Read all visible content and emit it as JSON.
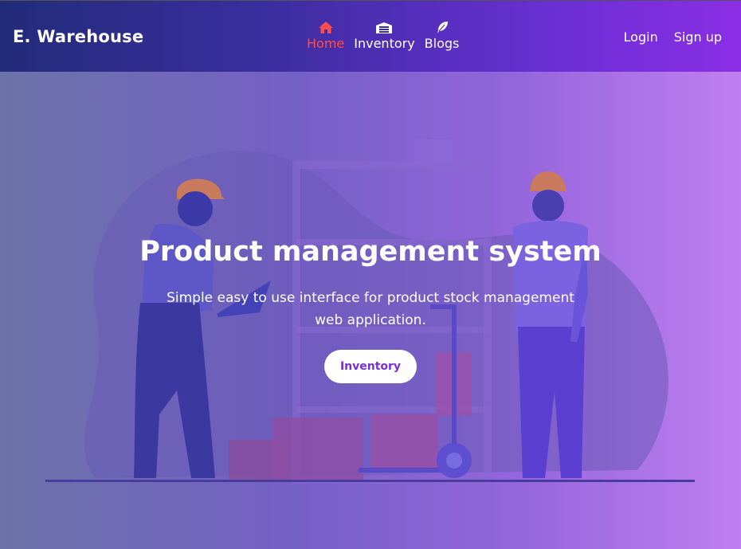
{
  "navbar": {
    "brand": "E. Warehouse",
    "links": [
      {
        "label": "Home",
        "icon": "home-icon",
        "active": true
      },
      {
        "label": "Inventory",
        "icon": "warehouse-icon",
        "active": false
      },
      {
        "label": "Blogs",
        "icon": "feather-icon",
        "active": false
      }
    ],
    "auth": {
      "login": "Login",
      "signup": "Sign up"
    }
  },
  "hero": {
    "title": "Product management system",
    "subtitle": "Simple easy to use interface for product stock management web application.",
    "button_label": "Inventory"
  },
  "colors": {
    "active_link": "#ff4d4d",
    "button_text": "#7b2fd6",
    "navbar_start": "#222b7a",
    "navbar_end": "#8b2ee6"
  }
}
